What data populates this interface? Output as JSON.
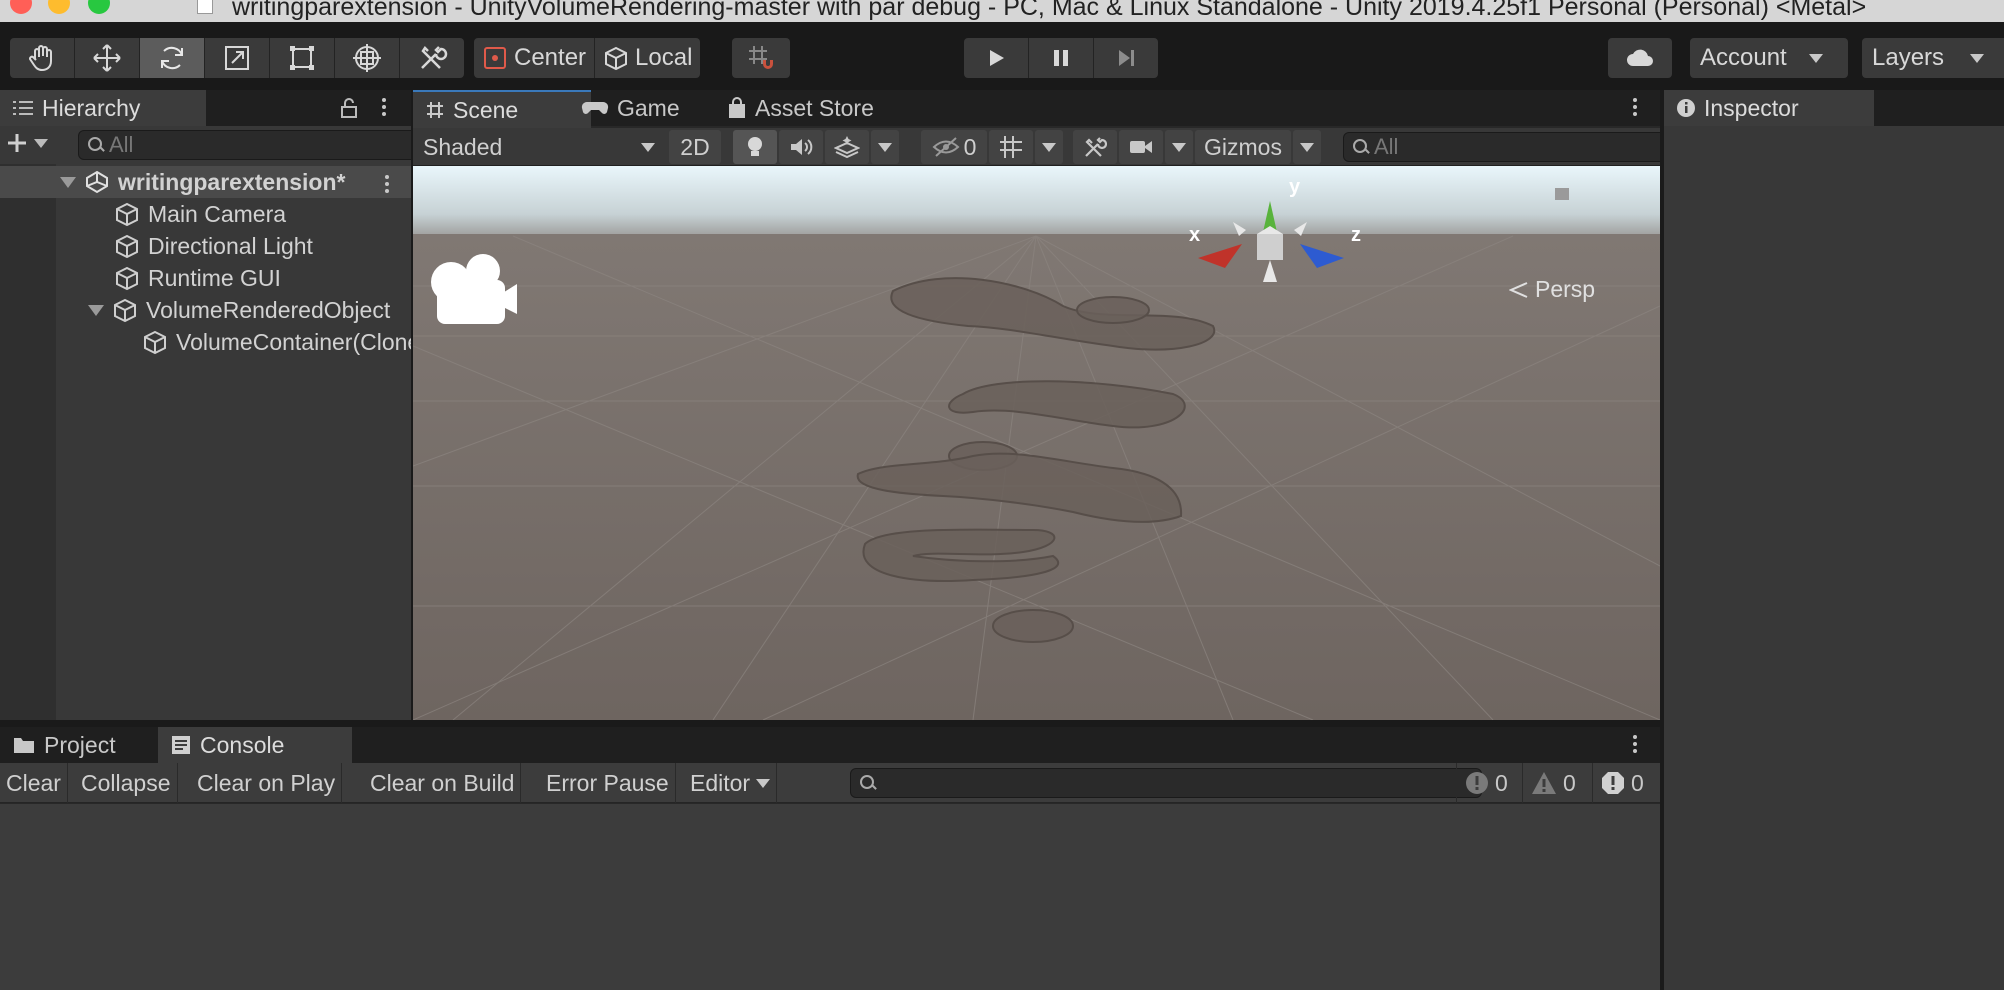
{
  "window": {
    "title": "writingparextension - UnityVolumeRendering-master with par debug - PC, Mac & Linux Standalone - Unity 2019.4.25f1 Personal (Personal) <Metal>",
    "traffic_colors": [
      "#ff5f57",
      "#febc2e",
      "#28c840"
    ]
  },
  "toolbar": {
    "tools": [
      {
        "name": "hand-tool",
        "icon": "hand-icon"
      },
      {
        "name": "move-tool",
        "icon": "move-icon"
      },
      {
        "name": "rotate-tool",
        "icon": "rotate-icon",
        "active": true
      },
      {
        "name": "scale-tool",
        "icon": "scale-icon"
      },
      {
        "name": "rect-tool",
        "icon": "rect-icon"
      },
      {
        "name": "transform-tool",
        "icon": "transform-icon"
      },
      {
        "name": "custom-tool",
        "icon": "tools-icon"
      }
    ],
    "pivot_label": "Center",
    "space_label": "Local",
    "account_label": "Account",
    "layers_label": "Layers"
  },
  "hierarchy": {
    "tab_label": "Hierarchy",
    "search_placeholder": "All",
    "scene_name": "writingparextension*",
    "items": [
      {
        "label": "Main Camera"
      },
      {
        "label": "Directional Light"
      },
      {
        "label": "Runtime GUI"
      },
      {
        "label": "VolumeRenderedObject"
      },
      {
        "label": "VolumeContainer(Clone)"
      }
    ]
  },
  "scene_tabs": {
    "scene": "Scene",
    "game": "Game",
    "asset_store": "Asset Store"
  },
  "scene_toolbar": {
    "shading_mode": "Shaded",
    "mode_2d": "2D",
    "hidden_count": "0",
    "gizmos": "Gizmos",
    "search_placeholder": "All"
  },
  "scene_view": {
    "gizmo_y": "y",
    "gizmo_x": "x",
    "gizmo_z": "z",
    "projection": "Persp"
  },
  "inspector": {
    "tab_label": "Inspector"
  },
  "bottom_tabs": {
    "project": "Project",
    "console": "Console"
  },
  "console": {
    "clear": "Clear",
    "collapse": "Collapse",
    "clear_on_play": "Clear on Play",
    "clear_on_build": "Clear on Build",
    "error_pause": "Error Pause",
    "editor": "Editor",
    "log_count": "0",
    "warning_count": "0",
    "error_count": "0"
  }
}
